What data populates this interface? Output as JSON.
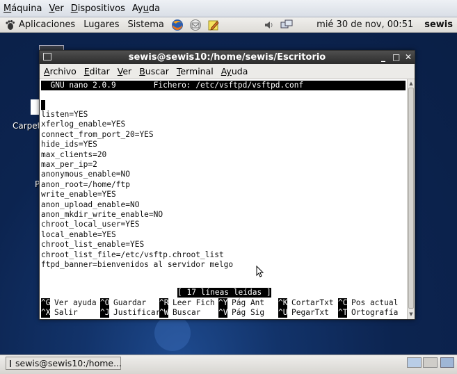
{
  "vbox_menubar": {
    "items": [
      {
        "pre": "",
        "u": "M",
        "post": "áquina"
      },
      {
        "pre": "",
        "u": "V",
        "post": "er"
      },
      {
        "pre": "",
        "u": "D",
        "post": "ispositivos"
      },
      {
        "pre": "Ay",
        "u": "u",
        "post": "da"
      }
    ]
  },
  "gnome_panel": {
    "applications": "Aplicaciones",
    "places": "Lugares",
    "system": "Sistema",
    "clock": "mié 30 de nov, 00:51",
    "user": "sewis"
  },
  "desktop": {
    "icon_label_1": "Carpeta",
    "icon_label_2": "P"
  },
  "terminal": {
    "title": "sewis@sewis10:/home/sewis/Escritorio",
    "menu": [
      {
        "u": "A",
        "rest": "rchivo"
      },
      {
        "u": "E",
        "rest": "ditar"
      },
      {
        "u": "V",
        "rest": "er"
      },
      {
        "u": "B",
        "rest": "uscar"
      },
      {
        "u": "T",
        "rest": "erminal"
      },
      {
        "u": "Ay",
        "rest": "uda"
      }
    ],
    "nano_header": "  GNU nano 2.0.9        Fichero: /etc/vsftpd/vsftpd.conf",
    "lines": [
      "listen=YES",
      "xferlog_enable=YES",
      "connect_from_port_20=YES",
      "hide_ids=YES",
      "max_clients=20",
      "max_per_ip=2",
      "anonymous_enable=NO",
      "anon_root=/home/ftp",
      "write_enable=YES",
      "anon_upload_enable=NO",
      "anon_mkdir_write_enable=NO",
      "chroot_local_user=YES",
      "local_enable=YES",
      "chroot_list_enable=YES",
      "chroot_list_file=/etc/vsftp.chroot_list",
      "ftpd_banner=bienvenidos al servidor melgo"
    ],
    "status": "[ 17 líneas leídas ]",
    "shortcuts_row1": [
      {
        "key": "^G",
        "label": "Ver ayuda"
      },
      {
        "key": "^O",
        "label": "Guardar"
      },
      {
        "key": "^R",
        "label": "Leer Fich"
      },
      {
        "key": "^Y",
        "label": "Pág Ant"
      },
      {
        "key": "^K",
        "label": "CortarTxt"
      },
      {
        "key": "^C",
        "label": "Pos actual"
      }
    ],
    "shortcuts_row2": [
      {
        "key": "^X",
        "label": "Salir"
      },
      {
        "key": "^J",
        "label": "Justificar"
      },
      {
        "key": "^W",
        "label": "Buscar"
      },
      {
        "key": "^V",
        "label": "Pág Sig"
      },
      {
        "key": "^U",
        "label": "PegarTxt"
      },
      {
        "key": "^T",
        "label": "Ortografía"
      }
    ]
  },
  "taskbar": {
    "window_button": "sewis@sewis10:/home..."
  },
  "colors": {
    "title_bar": "#3a3a3a",
    "desktop": "#0e2a55",
    "panel": "#e8e6e3"
  }
}
